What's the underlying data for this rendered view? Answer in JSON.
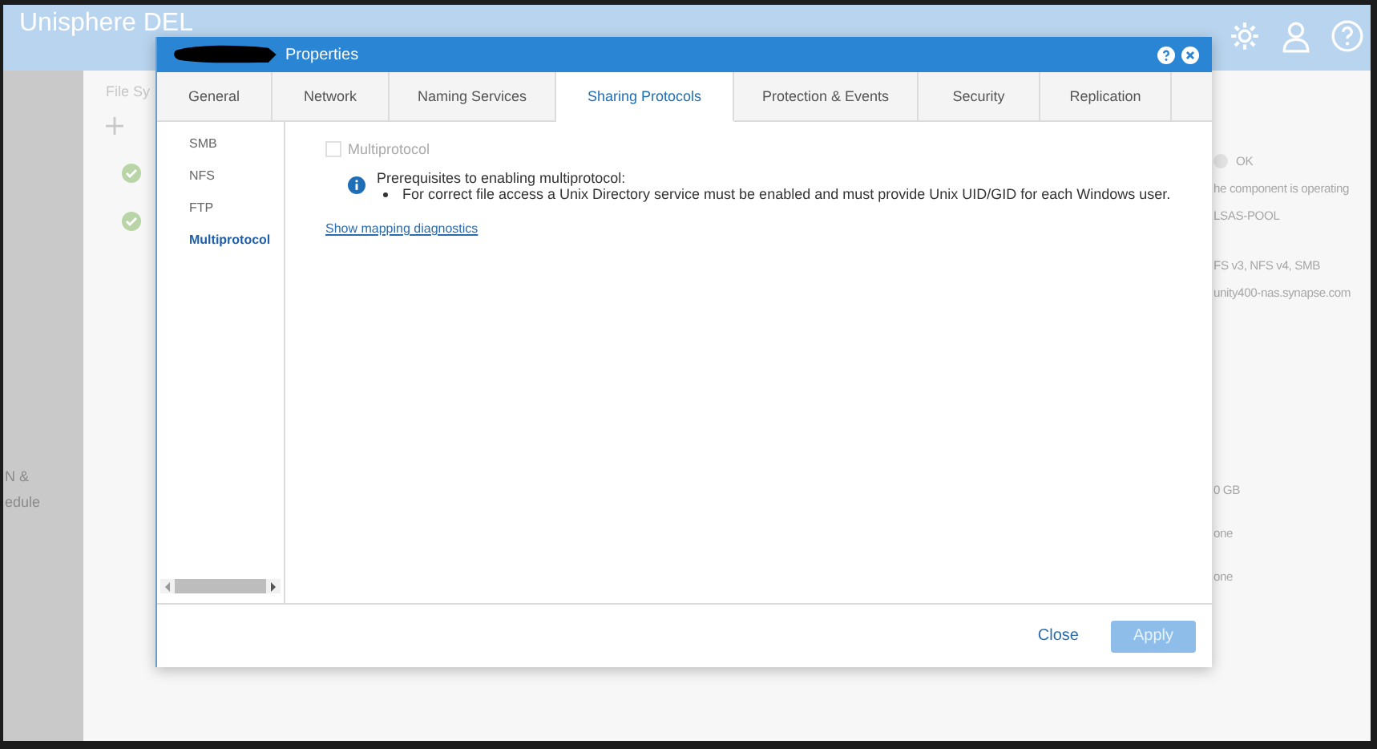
{
  "app": {
    "title": "Unisphere DEL"
  },
  "background": {
    "breadcrumb": "File Sy",
    "sidebar_fragments": [
      "N &",
      "edule"
    ],
    "status": {
      "label": "OK"
    },
    "detail_fragments": [
      {
        "text": "he component is operating",
        "kind": "line"
      },
      {
        "text": "LSAS-POOL",
        "kind": "line"
      },
      {
        "text": "FS v3, NFS v4, SMB",
        "kind": "gap"
      },
      {
        "text": "unity400-nas.synapse.com",
        "kind": "line"
      },
      {
        "text": "0 GB",
        "kind": "far"
      },
      {
        "text": "one",
        "kind": "mid"
      },
      {
        "text": "one",
        "kind": "mid"
      }
    ]
  },
  "dialog": {
    "title": "Properties",
    "redacted": true,
    "tabs": [
      {
        "label": "General",
        "selected": false
      },
      {
        "label": "Network",
        "selected": false
      },
      {
        "label": "Naming Services",
        "selected": false
      },
      {
        "label": "Sharing Protocols",
        "selected": true
      },
      {
        "label": "Protection & Events",
        "selected": false
      },
      {
        "label": "Security",
        "selected": false
      },
      {
        "label": "Replication",
        "selected": false
      }
    ],
    "nav": [
      {
        "label": "SMB",
        "selected": false
      },
      {
        "label": "NFS",
        "selected": false
      },
      {
        "label": "FTP",
        "selected": false
      },
      {
        "label": "Multiprotocol",
        "selected": true
      }
    ],
    "checkbox": {
      "label": "Multiprotocol",
      "checked": false,
      "disabled": true
    },
    "info": {
      "heading": "Prerequisites to enabling multiprotocol:",
      "bullets": [
        "For correct file access a Unix Directory service must be enabled and must provide Unix UID/GID for each Windows user."
      ]
    },
    "link": "Show mapping diagnostics",
    "buttons": [
      {
        "label": "Close",
        "kind": "link"
      },
      {
        "label": "Apply",
        "kind": "primary",
        "disabled": true
      }
    ]
  }
}
